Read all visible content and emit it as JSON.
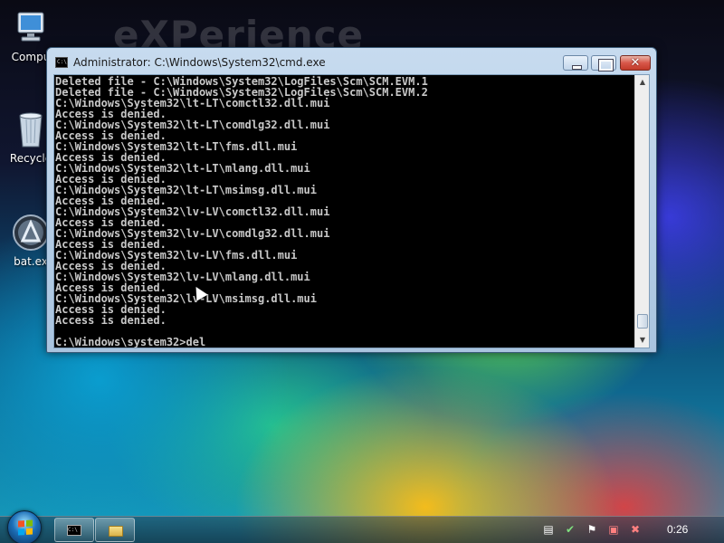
{
  "desktop": {
    "watermark": "eXPerience",
    "icons": [
      {
        "label": "Compu"
      },
      {
        "label": "Recycle"
      },
      {
        "label": "bat.ex"
      }
    ]
  },
  "window": {
    "title": "Administrator: C:\\Windows\\System32\\cmd.exe",
    "close_glyph": "✕",
    "console_lines": [
      "Deleted file - C:\\Windows\\System32\\LogFiles\\Scm\\SCM.EVM.1",
      "Deleted file - C:\\Windows\\System32\\LogFiles\\Scm\\SCM.EVM.2",
      "C:\\Windows\\System32\\lt-LT\\comctl32.dll.mui",
      "Access is denied.",
      "C:\\Windows\\System32\\lt-LT\\comdlg32.dll.mui",
      "Access is denied.",
      "C:\\Windows\\System32\\lt-LT\\fms.dll.mui",
      "Access is denied.",
      "C:\\Windows\\System32\\lt-LT\\mlang.dll.mui",
      "Access is denied.",
      "C:\\Windows\\System32\\lt-LT\\msimsg.dll.mui",
      "Access is denied.",
      "C:\\Windows\\System32\\lv-LV\\comctl32.dll.mui",
      "Access is denied.",
      "C:\\Windows\\System32\\lv-LV\\comdlg32.dll.mui",
      "Access is denied.",
      "C:\\Windows\\System32\\lv-LV\\fms.dll.mui",
      "Access is denied.",
      "C:\\Windows\\System32\\lv-LV\\mlang.dll.mui",
      "Access is denied.",
      "C:\\Windows\\System32\\lv-LV\\msimsg.dll.mui",
      "Access is denied.",
      "Access is denied."
    ],
    "prompt": "C:\\Windows\\system32>del"
  },
  "taskbar": {
    "clock": "0:26",
    "tray_icons": [
      "document-icon",
      "security-center-icon",
      "flag-icon",
      "network-icon",
      "volume-muted-icon"
    ]
  }
}
